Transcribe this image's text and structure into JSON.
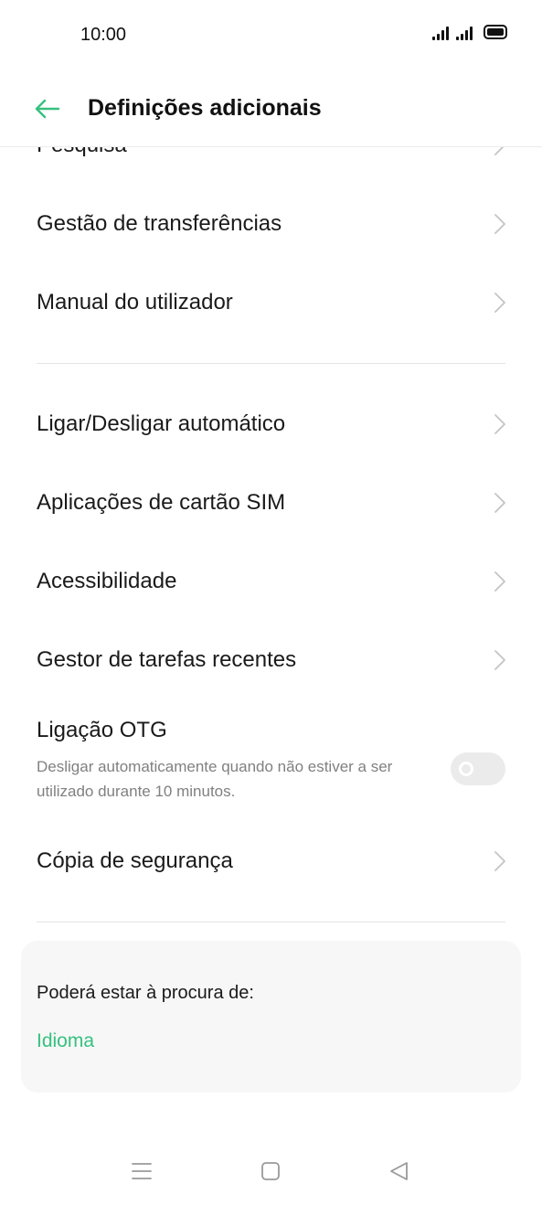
{
  "status_bar": {
    "time": "10:00",
    "icons": [
      "signal-icon",
      "signal-icon",
      "battery-icon"
    ]
  },
  "header": {
    "title": "Definições adicionais",
    "back_icon": "arrow-left-icon",
    "accent_color": "#35c17f"
  },
  "sections": [
    {
      "items": [
        {
          "label": "Pesquisa",
          "partial": true
        },
        {
          "label": "Gestão de transferências"
        },
        {
          "label": "Manual do utilizador"
        }
      ]
    },
    {
      "items": [
        {
          "label": "Ligar/Desligar automático"
        },
        {
          "label": "Aplicações de cartão SIM"
        },
        {
          "label": "Acessibilidade"
        },
        {
          "label": "Gestor de tarefas recentes"
        }
      ]
    }
  ],
  "otg": {
    "title": "Ligação OTG",
    "description": "Desligar automaticamente quando não estiver a ser utilizado durante 10 minutos.",
    "enabled": false
  },
  "backup": {
    "label": "Cópia de segurança"
  },
  "suggestions": {
    "heading": "Poderá estar à procura de:",
    "link": "Idioma",
    "link_color": "#35c17f"
  },
  "nav_bar": {
    "buttons": [
      "menu-icon",
      "home-icon",
      "back-triangle-icon"
    ]
  }
}
